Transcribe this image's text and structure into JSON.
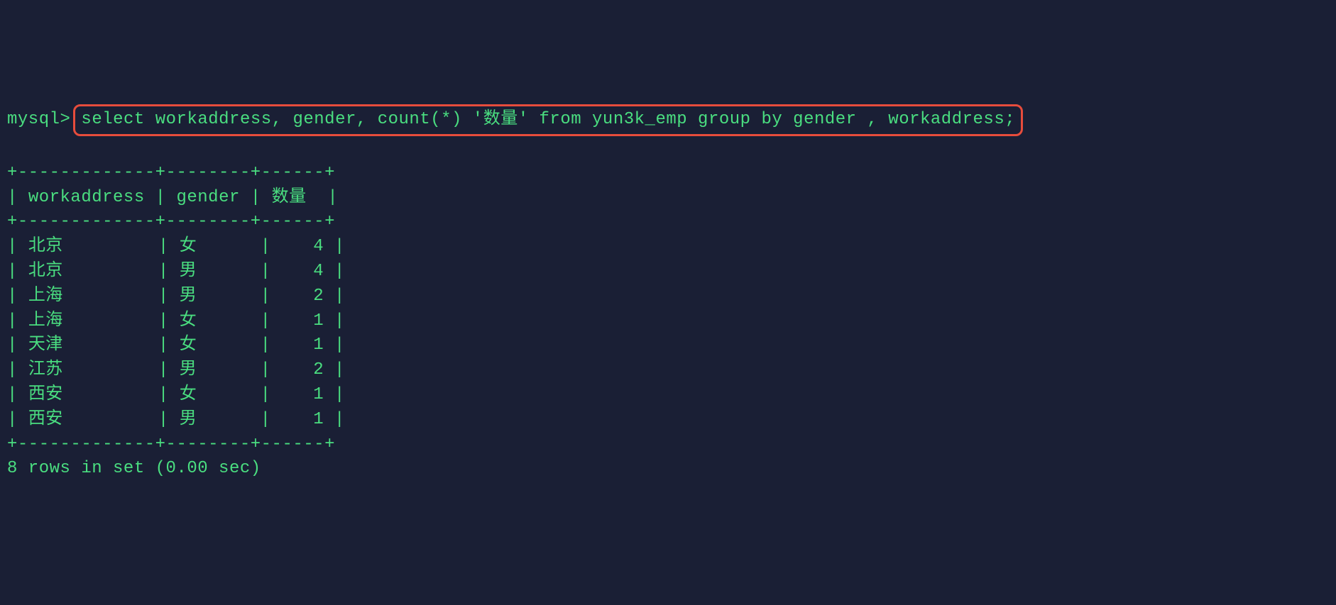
{
  "prompt": "mysql>",
  "query": "select workaddress, gender, count(*) '数量' from yun3k_emp group by gender , workaddress;",
  "table": {
    "top_divider": "+-------------+--------+------+",
    "bottom_divider": "+-------------+--------+------+",
    "header_divider": "+-------------+--------+------+",
    "headers": {
      "col1": "workaddress",
      "col2": "gender",
      "col3": "数量"
    },
    "rows": [
      {
        "workaddress": "北京",
        "gender": "女",
        "count": "4"
      },
      {
        "workaddress": "北京",
        "gender": "男",
        "count": "4"
      },
      {
        "workaddress": "上海",
        "gender": "男",
        "count": "2"
      },
      {
        "workaddress": "上海",
        "gender": "女",
        "count": "1"
      },
      {
        "workaddress": "天津",
        "gender": "女",
        "count": "1"
      },
      {
        "workaddress": "江苏",
        "gender": "男",
        "count": "2"
      },
      {
        "workaddress": "西安",
        "gender": "女",
        "count": "1"
      },
      {
        "workaddress": "西安",
        "gender": "男",
        "count": "1"
      }
    ]
  },
  "result_footer": "8 rows in set (0.00 sec)",
  "chart_data": {
    "type": "table",
    "title": "Count by workaddress and gender",
    "columns": [
      "workaddress",
      "gender",
      "数量"
    ],
    "rows": [
      [
        "北京",
        "女",
        4
      ],
      [
        "北京",
        "男",
        4
      ],
      [
        "上海",
        "男",
        2
      ],
      [
        "上海",
        "女",
        1
      ],
      [
        "天津",
        "女",
        1
      ],
      [
        "江苏",
        "男",
        2
      ],
      [
        "西安",
        "女",
        1
      ],
      [
        "西安",
        "男",
        1
      ]
    ]
  }
}
